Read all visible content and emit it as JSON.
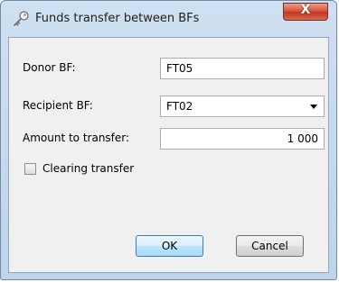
{
  "window": {
    "title": "Funds transfer between BFs",
    "close_glyph": "X",
    "icon": "key-icon"
  },
  "form": {
    "donor_label": "Donor BF:",
    "donor_value": "FT05",
    "recipient_label": "Recipient BF:",
    "recipient_value": "FT02",
    "amount_label": "Amount to transfer:",
    "amount_value": "1 000",
    "clearing_label": "Clearing transfer",
    "clearing_checked": false
  },
  "buttons": {
    "ok_label": "OK",
    "cancel_label": "Cancel"
  }
}
